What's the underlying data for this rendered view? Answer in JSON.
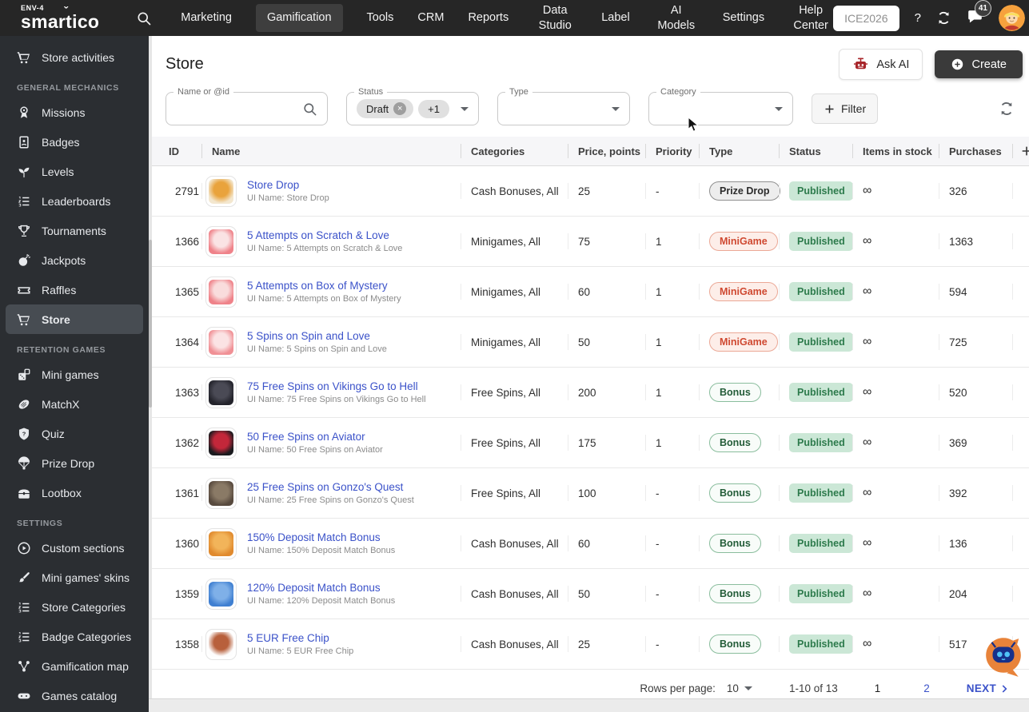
{
  "navbar": {
    "env_label": "ENV-4",
    "brand": "smartico",
    "items": [
      {
        "label": "Marketing",
        "active": false,
        "two_line": false
      },
      {
        "label": "Gamification",
        "active": true,
        "two_line": false
      },
      {
        "label": "Tools",
        "active": false,
        "two_line": false
      },
      {
        "label": "CRM",
        "active": false,
        "two_line": false
      },
      {
        "label": "Reports",
        "active": false,
        "two_line": false
      },
      {
        "label": "Data Studio",
        "active": false,
        "two_line": true
      },
      {
        "label": "Label",
        "active": false,
        "two_line": false
      },
      {
        "label": "AI Models",
        "active": false,
        "two_line": true
      },
      {
        "label": "Settings",
        "active": false,
        "two_line": false
      },
      {
        "label": "Help Center",
        "active": false,
        "two_line": true
      }
    ],
    "workspace": "ICE2026",
    "help_label": "?",
    "notifications_count": "41"
  },
  "sidebar": {
    "sections": [
      {
        "header": null,
        "items": [
          {
            "icon": "cart",
            "label": "Store activities",
            "active": false
          }
        ]
      },
      {
        "header": "GENERAL MECHANICS",
        "items": [
          {
            "icon": "medal",
            "label": "Missions",
            "active": false
          },
          {
            "icon": "badge",
            "label": "Badges",
            "active": false
          },
          {
            "icon": "plant",
            "label": "Levels",
            "active": false
          },
          {
            "icon": "list-ordered",
            "label": "Leaderboards",
            "active": false
          },
          {
            "icon": "trophy",
            "label": "Tournaments",
            "active": false
          },
          {
            "icon": "bomb",
            "label": "Jackpots",
            "active": false
          },
          {
            "icon": "ticket",
            "label": "Raffles",
            "active": false
          },
          {
            "icon": "cart",
            "label": "Store",
            "active": true
          }
        ]
      },
      {
        "header": "RETENTION GAMES",
        "items": [
          {
            "icon": "dice",
            "label": "Mini games",
            "active": false
          },
          {
            "icon": "ball",
            "label": "MatchX",
            "active": false
          },
          {
            "icon": "tag-question",
            "label": "Quiz",
            "active": false
          },
          {
            "icon": "parachute",
            "label": "Prize Drop",
            "active": false
          },
          {
            "icon": "chest",
            "label": "Lootbox",
            "active": false
          }
        ]
      },
      {
        "header": "SETTINGS",
        "items": [
          {
            "icon": "sections",
            "label": "Custom sections",
            "active": false
          },
          {
            "icon": "brush",
            "label": "Mini games' skins",
            "active": false
          },
          {
            "icon": "list-ordered",
            "label": "Store Categories",
            "active": false
          },
          {
            "icon": "list-ordered",
            "label": "Badge Categories",
            "active": false
          },
          {
            "icon": "nodes",
            "label": "Gamification map",
            "active": false
          },
          {
            "icon": "controller",
            "label": "Games catalog",
            "active": false
          }
        ]
      }
    ]
  },
  "page": {
    "title": "Store",
    "ask_ai_label": "Ask AI",
    "create_label": "Create"
  },
  "filters": {
    "name": {
      "label": "Name or @id",
      "value": ""
    },
    "status": {
      "label": "Status",
      "chips": [
        "Draft"
      ],
      "more_chip": "+1"
    },
    "type": {
      "label": "Type",
      "value": ""
    },
    "category": {
      "label": "Category",
      "value": ""
    },
    "filter_button": "Filter"
  },
  "table": {
    "columns": [
      "ID",
      "Name",
      "Categories",
      "Price, points",
      "Priority",
      "Type",
      "Status",
      "Items in stock",
      "Purchases"
    ],
    "rows": [
      {
        "id": "2791",
        "name": "Store Drop",
        "ui_name": "UI Name: Store Drop",
        "categories": "Cash Bonuses, All",
        "price": "25",
        "priority": "-",
        "type": "Prize Drop",
        "status": "Published",
        "stock": "∞",
        "purchases": "326",
        "thumb": {
          "base": "#f3e7cf",
          "accent": "#e9a33c"
        }
      },
      {
        "id": "1366",
        "name": "5 Attempts on Scratch & Love",
        "ui_name": "UI Name: 5 Attempts on Scratch & Love",
        "categories": "Minigames, All",
        "price": "75",
        "priority": "1",
        "type": "MiniGame",
        "status": "Published",
        "stock": "∞",
        "purchases": "1363",
        "thumb": {
          "base": "#ef8289",
          "accent": "#fae3e4"
        }
      },
      {
        "id": "1365",
        "name": "5 Attempts on Box of Mystery",
        "ui_name": "UI Name: 5 Attempts on Box of Mystery",
        "categories": "Minigames, All",
        "price": "60",
        "priority": "1",
        "type": "MiniGame",
        "status": "Published",
        "stock": "∞",
        "purchases": "594",
        "thumb": {
          "base": "#ef8289",
          "accent": "#f9dcdc"
        }
      },
      {
        "id": "1364",
        "name": "5 Spins on Spin and Love",
        "ui_name": "UI Name: 5 Spins on Spin and Love",
        "categories": "Minigames, All",
        "price": "50",
        "priority": "1",
        "type": "MiniGame",
        "status": "Published",
        "stock": "∞",
        "purchases": "725",
        "thumb": {
          "base": "#f09095",
          "accent": "#fbe3e4"
        }
      },
      {
        "id": "1363",
        "name": "75 Free Spins on Vikings Go to Hell",
        "ui_name": "UI Name: 75 Free Spins on Vikings Go to Hell",
        "categories": "Free Spins, All",
        "price": "200",
        "priority": "1",
        "type": "Bonus",
        "status": "Published",
        "stock": "∞",
        "purchases": "520",
        "thumb": {
          "base": "#23232b",
          "accent": "#4a4a55"
        }
      },
      {
        "id": "1362",
        "name": "50 Free Spins on Aviator",
        "ui_name": "UI Name: 50 Free Spins on Aviator",
        "categories": "Free Spins, All",
        "price": "175",
        "priority": "1",
        "type": "Bonus",
        "status": "Published",
        "stock": "∞",
        "purchases": "369",
        "thumb": {
          "base": "#1b1b1f",
          "accent": "#c3273a"
        }
      },
      {
        "id": "1361",
        "name": "25 Free Spins on Gonzo's Quest",
        "ui_name": "UI Name: 25 Free Spins on Gonzo's Quest",
        "categories": "Free Spins, All",
        "price": "100",
        "priority": "-",
        "type": "Bonus",
        "status": "Published",
        "stock": "∞",
        "purchases": "392",
        "thumb": {
          "base": "#584a3e",
          "accent": "#8a7a66"
        }
      },
      {
        "id": "1360",
        "name": "150% Deposit Match Bonus",
        "ui_name": "UI Name: 150% Deposit Match Bonus",
        "categories": "Cash Bonuses, All",
        "price": "60",
        "priority": "-",
        "type": "Bonus",
        "status": "Published",
        "stock": "∞",
        "purchases": "136",
        "thumb": {
          "base": "#e08a2e",
          "accent": "#f2b45a"
        }
      },
      {
        "id": "1359",
        "name": "120% Deposit Match Bonus",
        "ui_name": "UI Name: 120% Deposit Match Bonus",
        "categories": "Cash Bonuses, All",
        "price": "50",
        "priority": "-",
        "type": "Bonus",
        "status": "Published",
        "stock": "∞",
        "purchases": "204",
        "thumb": {
          "base": "#3f7fd1",
          "accent": "#7fb0e8"
        }
      },
      {
        "id": "1358",
        "name": "5 EUR Free Chip",
        "ui_name": "UI Name: 5 EUR Free Chip",
        "categories": "Cash Bonuses, All",
        "price": "25",
        "priority": "-",
        "type": "Bonus",
        "status": "Published",
        "stock": "∞",
        "purchases": "517",
        "thumb": {
          "base": "#fdfdfd",
          "accent": "#b8603c"
        }
      }
    ]
  },
  "pagination": {
    "rows_per_page_label": "Rows per page:",
    "rows_per_page_value": "10",
    "range": "1-10 of 13",
    "pages": [
      {
        "label": "1",
        "current": true
      },
      {
        "label": "2",
        "current": false
      }
    ],
    "next_label": "NEXT"
  },
  "colors": {
    "navbar_bg": "#262626",
    "sidebar_bg": "#2b2e32",
    "accent_link": "#3b52c9",
    "published_bg": "#cbe7d6",
    "published_text": "#2c7a4b",
    "minigame_text": "#cf4931",
    "bonus_text": "#235c38",
    "ask_ai_icon_red": "#a8262b",
    "create_button_bg": "#3a3a3a",
    "chat_widget_orange": "#e8833a"
  }
}
